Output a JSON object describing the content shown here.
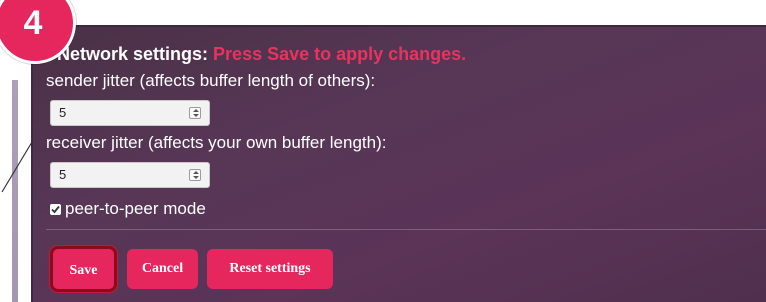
{
  "step_badge": "4",
  "network": {
    "heading": "Network settings:",
    "warning": "Press Save to apply changes.",
    "sender_jitter": {
      "label": "sender jitter (affects buffer length of others):",
      "value": "5"
    },
    "receiver_jitter": {
      "label": "receiver jitter (affects your own buffer length):",
      "value": "5"
    },
    "peer_to_peer": {
      "label": "peer-to-peer mode",
      "checked": true
    }
  },
  "buttons": {
    "save": "Save",
    "cancel": "Cancel",
    "reset": "Reset settings"
  },
  "colors": {
    "accent": "#e5275e",
    "warning_text": "#e8335f",
    "panel_bg": "#573656",
    "save_border": "#8a0b1e"
  }
}
